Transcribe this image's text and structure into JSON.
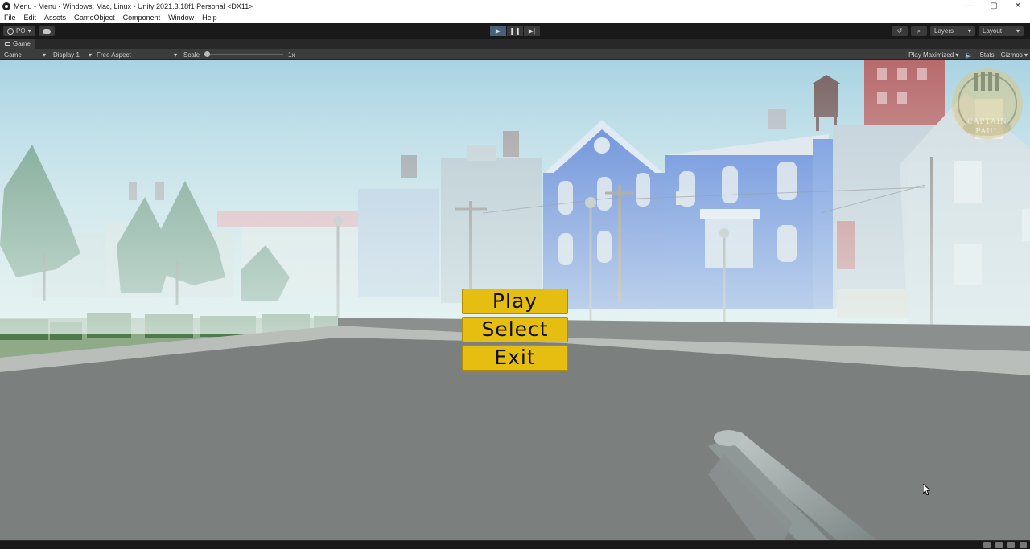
{
  "window": {
    "title": "Menu - Menu - Windows, Mac, Linux - Unity 2021.3.18f1 Personal <DX11>",
    "controls": [
      "—",
      "▢",
      "✕"
    ]
  },
  "menubar": [
    "File",
    "Edit",
    "Assets",
    "GameObject",
    "Component",
    "Window",
    "Help"
  ],
  "toolbar": {
    "account": "PO",
    "layers_label": "Layers",
    "layout_label": "Layout",
    "play_state": "playing"
  },
  "game_tab": {
    "tab_label": "Game",
    "view_mode": "Game",
    "display": "Display 1",
    "aspect": "Free Aspect",
    "scale_label": "Scale",
    "scale_value": "1x",
    "play_mode": "Play Maximized",
    "stats": "Stats",
    "gizmos": "Gizmos"
  },
  "game_menu": {
    "buttons": [
      "Play",
      "Select",
      "Exit"
    ],
    "button_color": "#e6be12"
  },
  "watermark": {
    "line1": "CAPTAIN",
    "line2": "PAUL"
  },
  "colors": {
    "editor_dark": "#191919",
    "panel": "#3c3c3c",
    "sky": "#bfe3ef",
    "ground": "#7b7f7d"
  }
}
